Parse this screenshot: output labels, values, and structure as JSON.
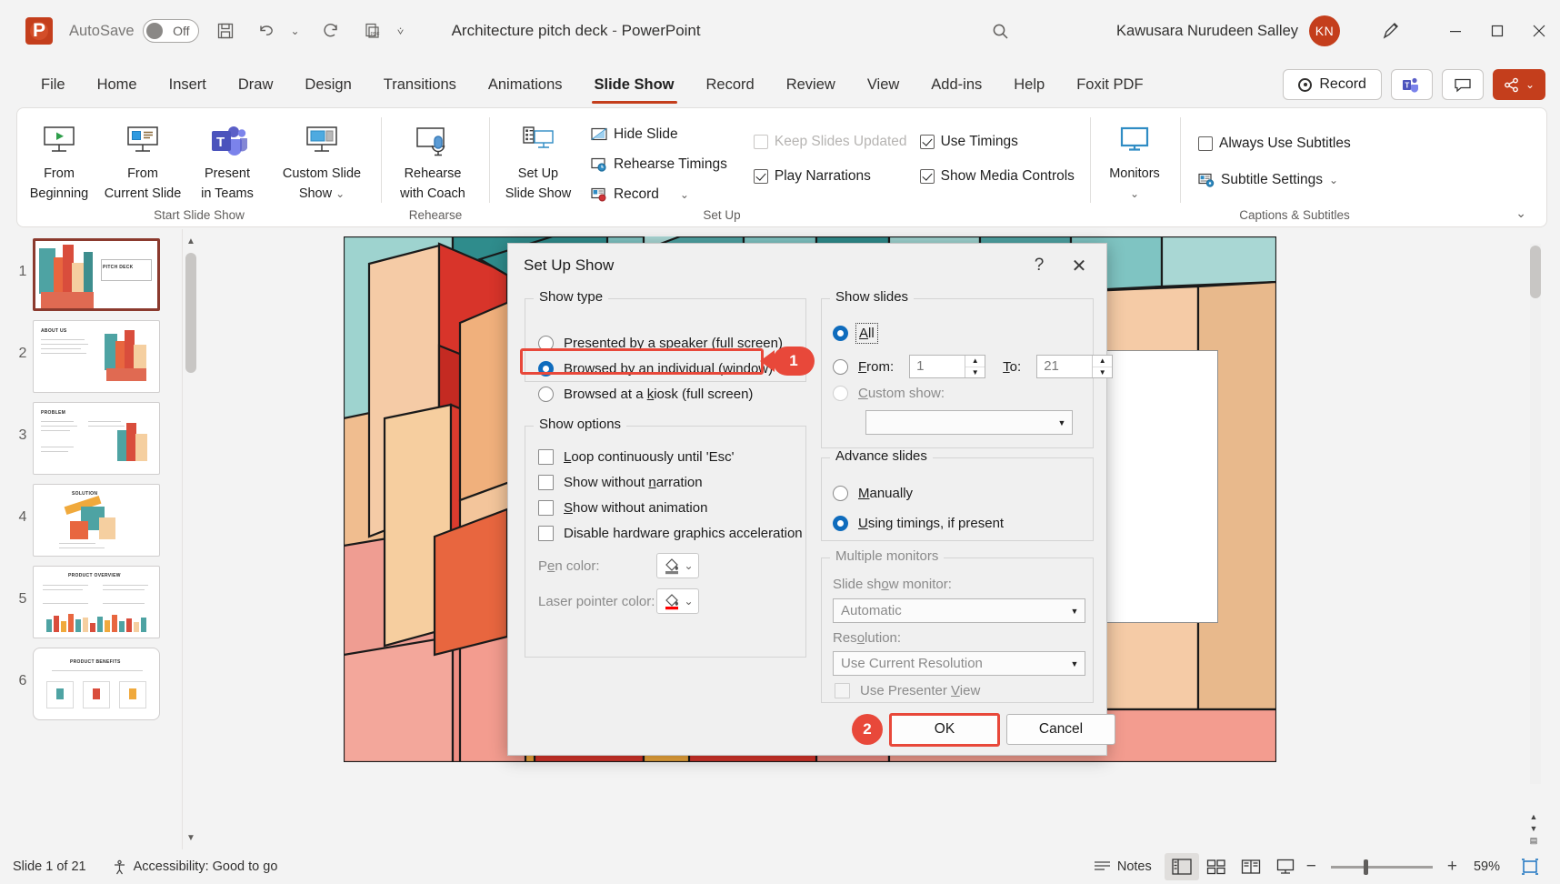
{
  "titlebar": {
    "autosave_label": "AutoSave",
    "autosave_state": "Off",
    "doc_title": "Architecture pitch deck",
    "doc_sep": "-",
    "app_name": "PowerPoint",
    "user_name": "Kawusara Nurudeen Salley",
    "avatar_initials": "KN",
    "icons": [
      "save-icon",
      "undo-icon",
      "redo-icon",
      "export-pdf-icon",
      "customize-quick-access-icon",
      "search-icon",
      "pen-icon"
    ],
    "window_buttons": [
      "minimize",
      "maximize",
      "close"
    ]
  },
  "tabs": {
    "items": [
      {
        "label": "File",
        "active": false
      },
      {
        "label": "Home",
        "active": false
      },
      {
        "label": "Insert",
        "active": false
      },
      {
        "label": "Draw",
        "active": false
      },
      {
        "label": "Design",
        "active": false
      },
      {
        "label": "Transitions",
        "active": false
      },
      {
        "label": "Animations",
        "active": false
      },
      {
        "label": "Slide Show",
        "active": true
      },
      {
        "label": "Record",
        "active": false
      },
      {
        "label": "Review",
        "active": false
      },
      {
        "label": "View",
        "active": false
      },
      {
        "label": "Add-ins",
        "active": false
      },
      {
        "label": "Help",
        "active": false
      },
      {
        "label": "Foxit PDF",
        "active": false
      }
    ],
    "record_button": "Record",
    "teams_button": "present-in-teams-icon",
    "comments_button": "comments-icon",
    "share_button": "share-icon",
    "accent_color": "#c43e1c"
  },
  "ribbon": {
    "groups": [
      {
        "label": "Start Slide Show",
        "buttons": [
          {
            "label_line1": "From",
            "label_line2": "Beginning",
            "icon": "from-beginning-icon"
          },
          {
            "label_line1": "From",
            "label_line2": "Current Slide",
            "icon": "from-current-slide-icon"
          },
          {
            "label_line1": "Present",
            "label_line2": "in Teams",
            "icon": "teams-icon"
          },
          {
            "label_line1": "Custom Slide",
            "label_line2": "Show",
            "icon": "custom-slide-show-icon",
            "dropdown": true
          }
        ]
      },
      {
        "label": "Rehearse",
        "buttons": [
          {
            "label_line1": "Rehearse",
            "label_line2": "with Coach",
            "icon": "rehearse-with-coach-icon"
          }
        ]
      },
      {
        "label": "Set Up",
        "buttons": [
          {
            "label_line1": "Set Up",
            "label_line2": "Slide Show",
            "icon": "set-up-slide-show-icon"
          }
        ],
        "small_items": [
          {
            "label": "Hide Slide",
            "icon": "hide-slide-icon",
            "type": "button"
          },
          {
            "label": "Rehearse Timings",
            "icon": "rehearse-timings-icon",
            "type": "button"
          },
          {
            "label": "Record",
            "icon": "record-icon",
            "type": "button",
            "dropdown": true
          },
          {
            "label": "Keep Slides Updated",
            "type": "checkbox",
            "checked": false,
            "disabled": true
          },
          {
            "label": "Play Narrations",
            "type": "checkbox",
            "checked": true,
            "disabled": false
          },
          {
            "label": "Use Timings",
            "type": "checkbox",
            "checked": true,
            "disabled": false
          },
          {
            "label": "Show Media Controls",
            "type": "checkbox",
            "checked": true,
            "disabled": false
          }
        ]
      },
      {
        "label": "",
        "buttons": [
          {
            "label_line1": "Monitors",
            "label_line2": "",
            "icon": "monitor-icon",
            "dropdown": true
          }
        ]
      },
      {
        "label": "Captions & Subtitles",
        "small_items": [
          {
            "label": "Always Use Subtitles",
            "type": "checkbox",
            "checked": false,
            "disabled": false
          },
          {
            "label": "Subtitle Settings",
            "icon": "subtitle-settings-icon",
            "type": "button",
            "dropdown": true
          }
        ]
      }
    ]
  },
  "thumbnails": {
    "slides": [
      {
        "number": "1",
        "title": "PITCH DECK",
        "selected": true
      },
      {
        "number": "2",
        "title": "ABOUT US",
        "selected": false
      },
      {
        "number": "3",
        "title": "PROBLEM",
        "selected": false
      },
      {
        "number": "4",
        "title": "SOLUTION",
        "selected": false
      },
      {
        "number": "5",
        "title": "PRODUCT OVERVIEW",
        "selected": false
      },
      {
        "number": "6",
        "title": "PRODUCT BENEFITS",
        "selected": false
      }
    ]
  },
  "dialog": {
    "title": "Set Up Show",
    "help_icon": "?",
    "close_icon": "✕",
    "show_type": {
      "caption": "Show type",
      "options": [
        {
          "label": "Presented by a speaker (full screen)",
          "mnemonic": "P",
          "selected": false
        },
        {
          "label": "Browsed by an individual (window)",
          "mnemonic": "B",
          "selected": true,
          "highlighted": true
        },
        {
          "label": "Browsed at a kiosk (full screen)",
          "mnemonic": "k",
          "selected": false
        }
      ]
    },
    "show_options": {
      "caption": "Show options",
      "checkboxes": [
        {
          "label": "Loop continuously until 'Esc'",
          "mnemonic": "L",
          "checked": false
        },
        {
          "label": "Show without narration",
          "mnemonic": "n",
          "checked": false
        },
        {
          "label": "Show without animation",
          "mnemonic": "S",
          "checked": false
        },
        {
          "label": "Disable hardware graphics acceleration",
          "mnemonic": "g",
          "checked": false
        }
      ],
      "pen_color_label": "Pen color:",
      "pen_color_value": "#7f7f7f",
      "laser_pointer_label": "Laser pointer color:",
      "laser_pointer_value": "#ff0000"
    },
    "show_slides": {
      "caption": "Show slides",
      "all_label": "All",
      "all_selected": true,
      "from_label": "From:",
      "from_value": "1",
      "to_label": "To:",
      "to_value": "21",
      "from_selected": false,
      "custom_show_label": "Custom show:",
      "custom_show_selected": false,
      "custom_show_value": ""
    },
    "advance_slides": {
      "caption": "Advance slides",
      "options": [
        {
          "label": "Manually",
          "mnemonic": "M",
          "selected": false
        },
        {
          "label": "Using timings, if present",
          "mnemonic": "U",
          "selected": true
        }
      ]
    },
    "multiple_monitors": {
      "caption": "Multiple monitors",
      "monitor_label": "Slide show monitor:",
      "monitor_value": "Automatic",
      "resolution_label": "Resolution:",
      "resolution_value": "Use Current Resolution",
      "presenter_view_label": "Use Presenter View",
      "presenter_view_checked": false
    },
    "ok_label": "OK",
    "cancel_label": "Cancel"
  },
  "annotations": {
    "step1": "1",
    "step2": "2",
    "color": "#e8483a"
  },
  "statusbar": {
    "slide_counter": "Slide 1 of 21",
    "accessibility": "Accessibility: Good to go",
    "notes_label": "Notes",
    "zoom_level": "59%",
    "views": [
      "normal-view-icon",
      "slide-sorter-icon",
      "reading-view-icon",
      "slide-show-icon"
    ],
    "zoom_out": "−",
    "zoom_in": "+",
    "fit_slide": "fit-to-window-icon"
  }
}
